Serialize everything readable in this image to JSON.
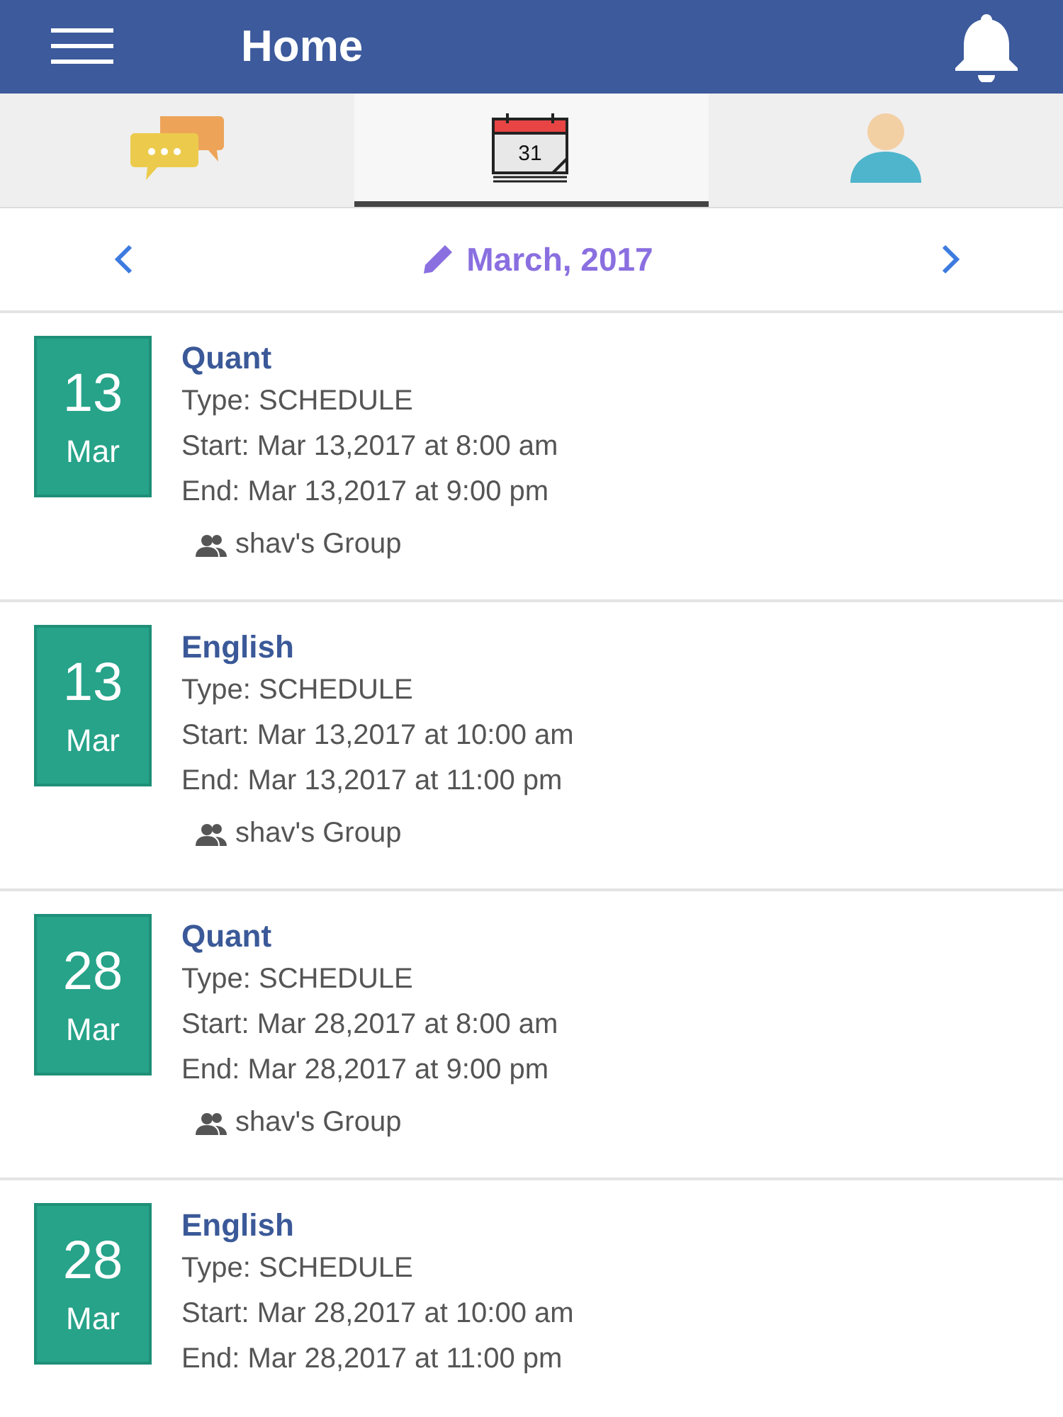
{
  "header": {
    "title": "Home"
  },
  "tabs": [
    {
      "kind": "chat",
      "selected": false
    },
    {
      "kind": "calendar",
      "icon_text": "31",
      "selected": true
    },
    {
      "kind": "profile",
      "selected": false
    }
  ],
  "month_nav": {
    "label": "March, 2017"
  },
  "events": [
    {
      "day": "13",
      "month": "Mar",
      "title": "Quant",
      "type": "Type: SCHEDULE",
      "start": "Start: Mar 13,2017 at 8:00 am",
      "end": "End: Mar 13,2017 at 9:00 pm",
      "group": "shav's Group"
    },
    {
      "day": "13",
      "month": "Mar",
      "title": "English",
      "type": "Type: SCHEDULE",
      "start": "Start: Mar 13,2017 at 10:00 am",
      "end": "End: Mar 13,2017 at 11:00 pm",
      "group": "shav's Group"
    },
    {
      "day": "28",
      "month": "Mar",
      "title": "Quant",
      "type": "Type: SCHEDULE",
      "start": "Start: Mar 28,2017 at 8:00 am",
      "end": "End: Mar 28,2017 at 9:00 pm",
      "group": "shav's Group"
    },
    {
      "day": "28",
      "month": "Mar",
      "title": "English",
      "type": "Type: SCHEDULE",
      "start": "Start: Mar 28,2017 at 10:00 am",
      "end": "End: Mar 28,2017 at 11:00 pm"
    }
  ]
}
